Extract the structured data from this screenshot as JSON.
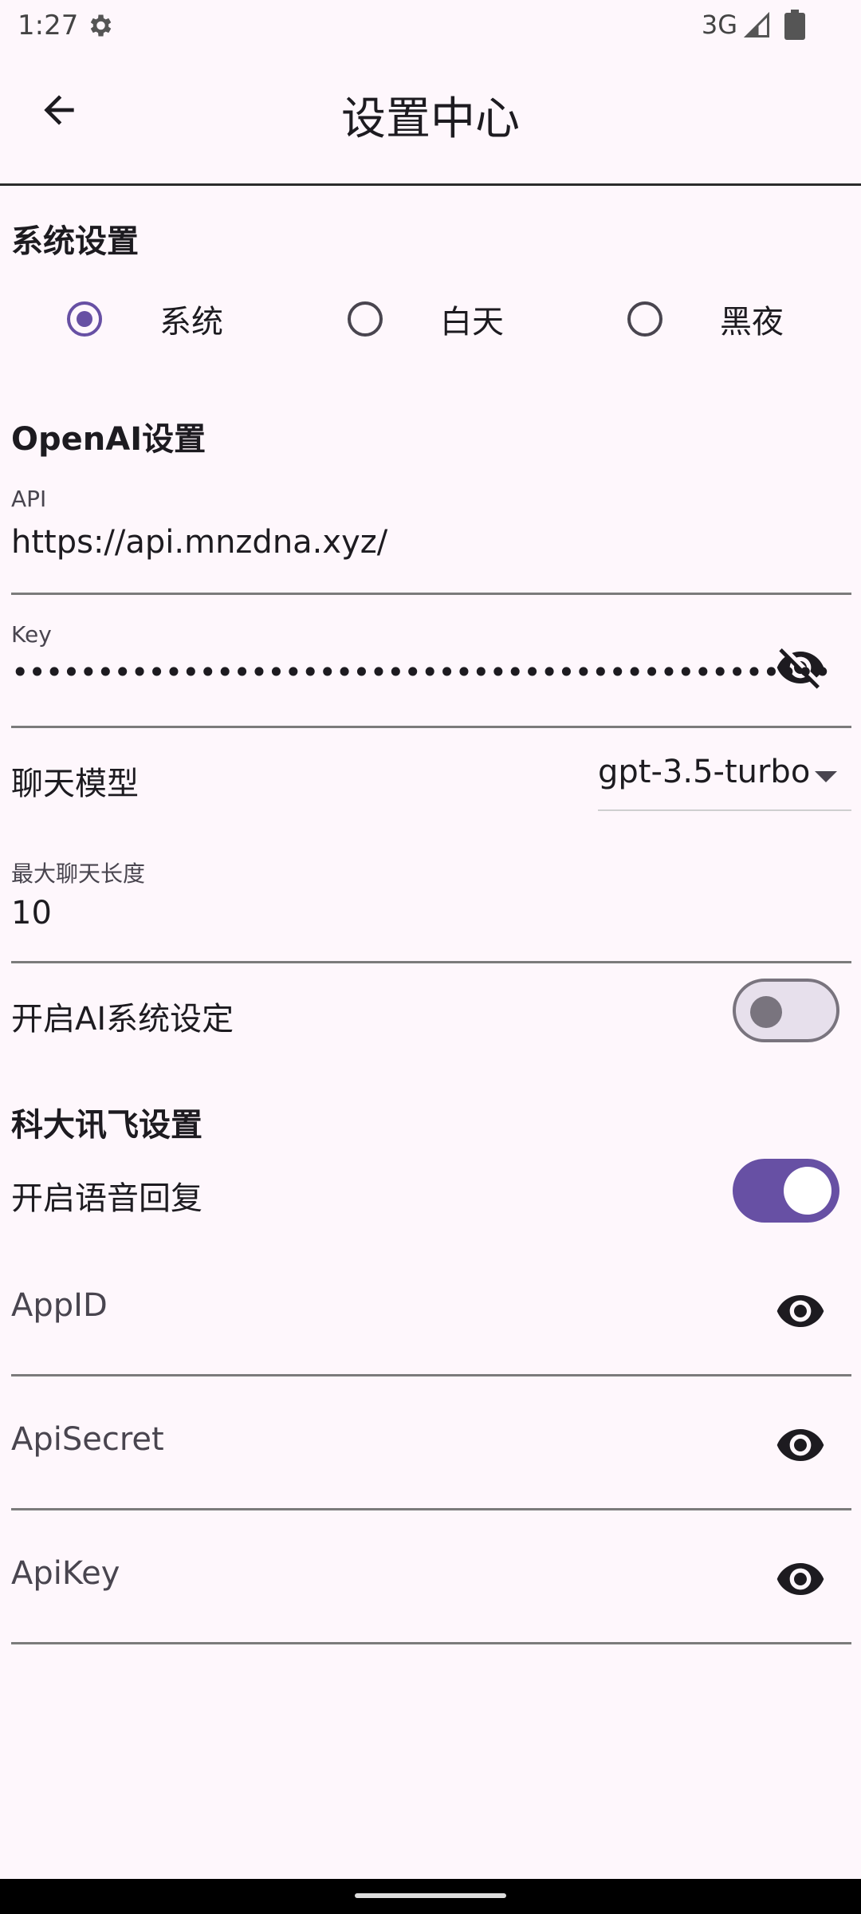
{
  "status_bar": {
    "time": "1:27",
    "network": "3G"
  },
  "app_bar": {
    "title": "设置中心"
  },
  "system_settings": {
    "title": "系统设置",
    "theme_options": [
      {
        "label": "系统",
        "selected": true
      },
      {
        "label": "白天",
        "selected": false
      },
      {
        "label": "黑夜",
        "selected": false
      }
    ]
  },
  "openai_settings": {
    "title": "OpenAI设置",
    "api": {
      "label": "API",
      "value": "https://api.mnzdna.xyz/"
    },
    "key": {
      "label": "Key",
      "value": "••••••••••••••••••••••••••••••••••••••••••••••••"
    },
    "chat_model": {
      "label": "聊天模型",
      "value": "gpt-3.5-turbo"
    },
    "max_length": {
      "label": "最大聊天长度",
      "value": "10"
    },
    "ai_system": {
      "label": "开启AI系统设定",
      "enabled": false
    }
  },
  "iflytek_settings": {
    "title": "科大讯飞设置",
    "voice_reply": {
      "label": "开启语音回复",
      "enabled": true
    },
    "app_id": {
      "placeholder": "AppID"
    },
    "api_secret": {
      "placeholder": "ApiSecret"
    },
    "api_key": {
      "placeholder": "ApiKey"
    }
  },
  "colors": {
    "accent": "#6750a4",
    "background": "#fef7fc"
  }
}
